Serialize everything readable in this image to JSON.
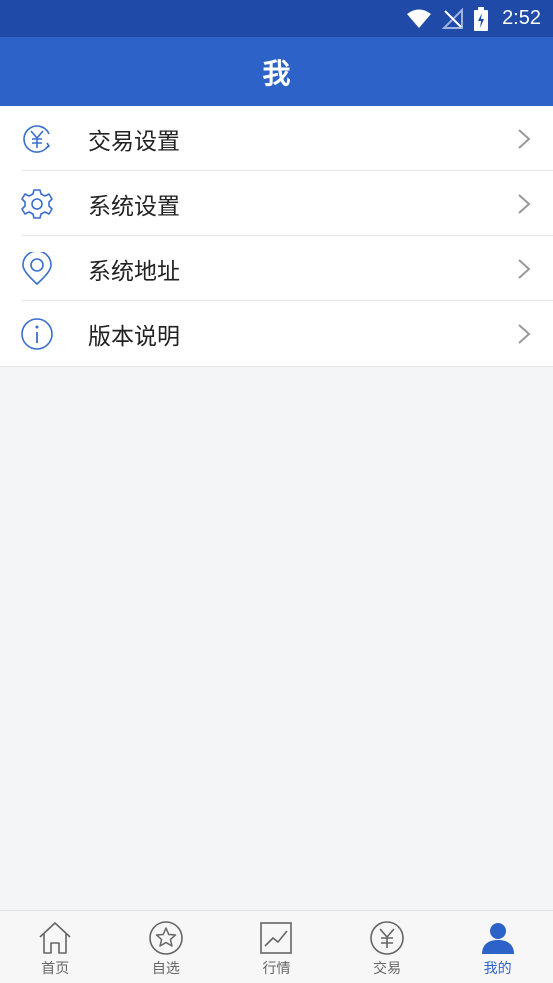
{
  "status_bar": {
    "time": "2:52",
    "icons": [
      "wifi-icon",
      "no-signal-icon",
      "battery-charging-icon"
    ]
  },
  "header": {
    "title": "我"
  },
  "menu": {
    "items": [
      {
        "label": "交易设置",
        "icon": "yen-refresh-icon"
      },
      {
        "label": "系统设置",
        "icon": "gear-icon"
      },
      {
        "label": "系统地址",
        "icon": "location-pin-icon"
      },
      {
        "label": "版本说明",
        "icon": "info-icon"
      }
    ]
  },
  "tabbar": {
    "tabs": [
      {
        "label": "首页",
        "icon": "home-icon",
        "active": false
      },
      {
        "label": "自选",
        "icon": "star-icon",
        "active": false
      },
      {
        "label": "行情",
        "icon": "chart-icon",
        "active": false
      },
      {
        "label": "交易",
        "icon": "yen-icon",
        "active": false
      },
      {
        "label": "我的",
        "icon": "user-icon",
        "active": true
      }
    ],
    "active_color": "#2d63c8",
    "inactive_color": "#666666"
  },
  "colors": {
    "status_bar_bg": "#1f4aa8",
    "title_bar_bg": "#2d63c8",
    "icon_blue": "#3a6fcf",
    "page_bg": "#f4f5f7"
  }
}
